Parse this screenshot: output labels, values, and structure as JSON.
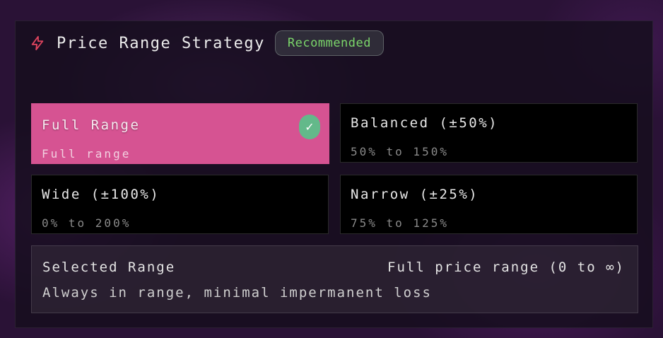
{
  "header": {
    "icon": "lightning-bolt-icon",
    "title": "Price Range Strategy",
    "badge": "Recommended"
  },
  "options": [
    {
      "name": "Full Range",
      "desc": "Full range",
      "selected": true
    },
    {
      "name": "Balanced (±50%)",
      "desc": "50% to 150%",
      "selected": false
    },
    {
      "name": "Wide (±100%)",
      "desc": "0% to 200%",
      "selected": false
    },
    {
      "name": "Narrow (±25%)",
      "desc": "75% to 125%",
      "selected": false
    }
  ],
  "check_glyph": "✓",
  "summary": {
    "label": "Selected Range",
    "value": "Full price range (0 to ∞)",
    "description": "Always in range, minimal impermanent loss"
  },
  "colors": {
    "accent_pink": "#d65392",
    "badge_green": "#7bd66a",
    "check_green": "#63b98a",
    "bolt_red": "#e0455f"
  }
}
